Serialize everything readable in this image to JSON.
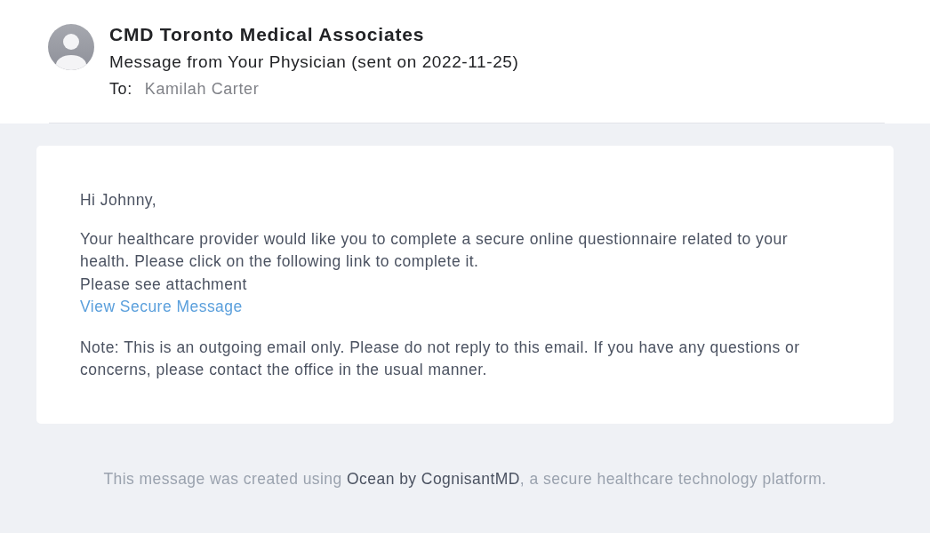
{
  "header": {
    "sender": "CMD Toronto Medical Associates",
    "subject": "Message from Your Physician (sent on 2022-11-25)",
    "to_label": "To:",
    "to": "Kamilah Carter"
  },
  "message": {
    "greeting": "Hi Johnny,",
    "body": [
      {
        "kind": "text",
        "text": "Your healthcare provider would like you to complete a secure online questionnaire related to your health. Please click on the following link to complete it."
      },
      {
        "kind": "text",
        "text": "Please see attachment"
      },
      {
        "kind": "link",
        "text": "View Secure Message"
      }
    ],
    "note": "Note: This is an outgoing email only. Please do not reply to this email. If you have any questions or concerns, please contact the office in the usual manner."
  },
  "footer": {
    "before": "This message was created using",
    "link": "Ocean by CognisantMD",
    "after": ", a secure healthcare technology platform."
  }
}
